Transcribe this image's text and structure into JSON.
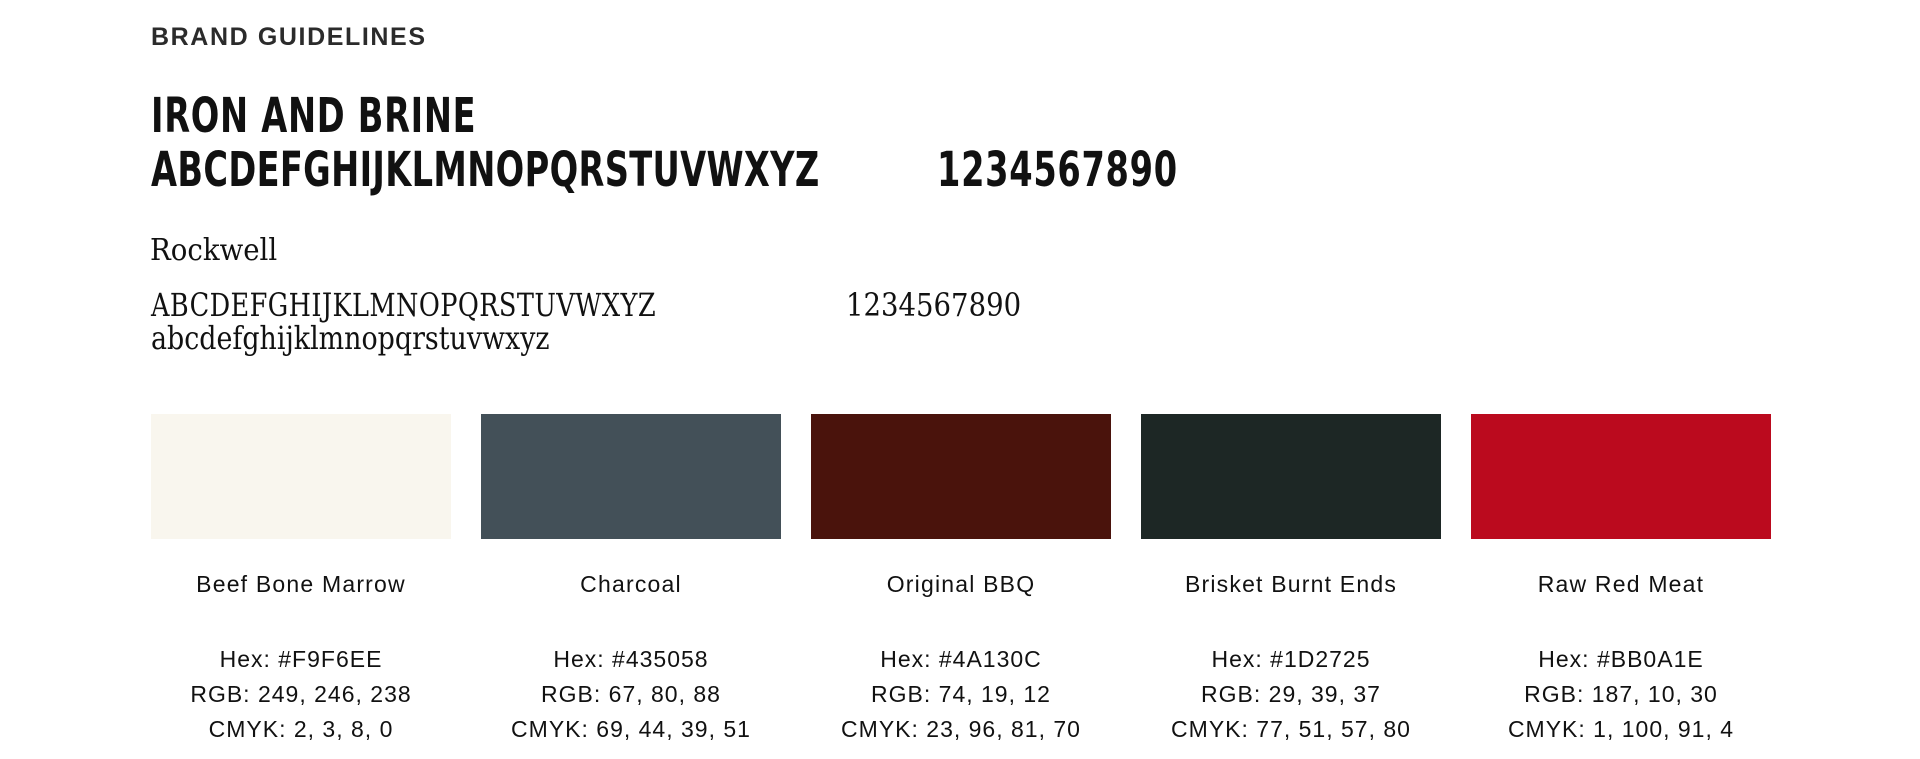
{
  "header": {
    "overline": "BRAND GUIDELINES"
  },
  "display_type": {
    "brand_name": "IRON AND BRINE",
    "alphabet": "ABCDEFGHIJKLMNOPQRSTUVWXYZ",
    "digits": "1234567890"
  },
  "secondary_type": {
    "font_name": "Rockwell",
    "uppercase": "ABCDEFGHIJKLMNOPQRSTUVWXYZ",
    "digits": "1234567890",
    "lowercase": "abcdefghijklmnopqrstuvwxyz"
  },
  "palette": [
    {
      "name": "Beef Bone Marrow",
      "color": "#F9F6EE",
      "hex": "Hex: #F9F6EE",
      "rgb": "RGB: 249, 246, 238",
      "cmyk": "CMYK: 2, 3, 8, 0"
    },
    {
      "name": "Charcoal",
      "color": "#435058",
      "hex": "Hex: #435058",
      "rgb": "RGB: 67, 80, 88",
      "cmyk": "CMYK: 69, 44, 39, 51"
    },
    {
      "name": "Original BBQ",
      "color": "#4A130C",
      "hex": "Hex: #4A130C",
      "rgb": "RGB: 74, 19, 12",
      "cmyk": "CMYK: 23, 96, 81, 70"
    },
    {
      "name": "Brisket Burnt Ends",
      "color": "#1D2725",
      "hex": "Hex: #1D2725",
      "rgb": "RGB: 29, 39, 37",
      "cmyk": "CMYK: 77, 51, 57, 80"
    },
    {
      "name": "Raw Red Meat",
      "color": "#BB0A1E",
      "hex": "Hex: #BB0A1E",
      "rgb": "RGB: 187, 10, 30",
      "cmyk": "CMYK: 1, 100, 91, 4"
    }
  ]
}
